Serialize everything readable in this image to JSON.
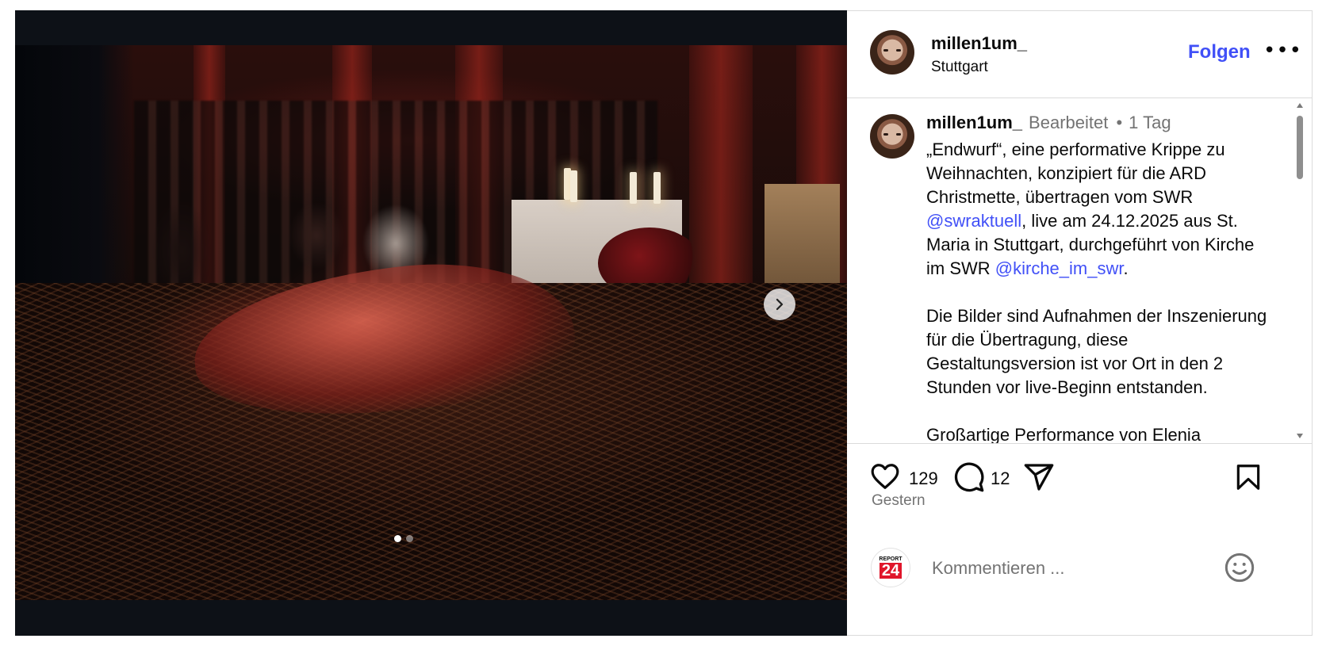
{
  "post": {
    "username": "millen1um_",
    "location": "Stuttgart",
    "follow_label": "Folgen",
    "more_label": "•••",
    "edited_label": "Bearbeitet",
    "separator": "•",
    "age": "1 Tag",
    "caption_part1": "„Endwurf“, eine performative Krippe zu Weihnachten, konzipiert für die ARD Christmette, übertragen vom SWR ",
    "mention1": "@swraktuell",
    "caption_part2": ", live am 24.12.2025 aus St. Maria in Stuttgart, durchgeführt von Kirche im SWR ",
    "mention2": "@kirche_im_swr",
    "caption_part3": ".\n\nDie Bilder sind Aufnahmen der Inszenierung für die Übertragung, diese Gestaltungsversion ist vor Ort in den 2 Stunden vor live-Beginn entstanden.\n\nGroßartige Performance von Elenia"
  },
  "actions": {
    "likes": "129",
    "comments": "12",
    "date": "Gestern"
  },
  "comment_box": {
    "placeholder": "Kommentieren ...",
    "commenter_logo_top": "REPORT",
    "commenter_logo_num": "24"
  },
  "carousel": {
    "count": 2,
    "active_index": 0
  },
  "colors": {
    "accent": "#4150f7",
    "muted": "#737373",
    "border": "#dbdbdb"
  },
  "icons": [
    "chevron-right-icon",
    "heart-icon",
    "comment-icon",
    "share-icon",
    "bookmark-icon",
    "emoji-icon",
    "more-icon"
  ]
}
